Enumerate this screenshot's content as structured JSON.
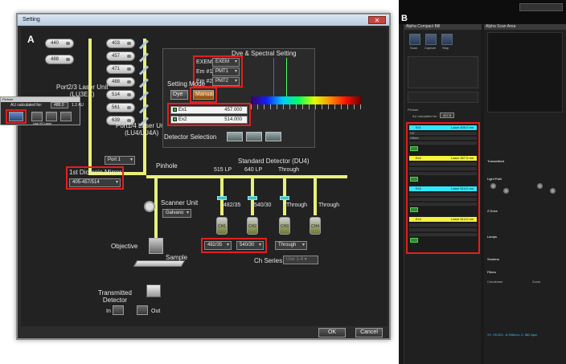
{
  "panel_a": {
    "letter": "A",
    "window_title": "Setting",
    "close_label": "✕",
    "lasers_left": [
      "440",
      "488"
    ],
    "lasers_right": [
      "403",
      "457",
      "471",
      "488",
      "514",
      "561",
      "639"
    ],
    "laser_unit_left": "Port2/3 Laser Unit\n(LU3EX)",
    "laser_unit_right": "Port1/4 Laser Unit\n(LU4/LU4A)",
    "dye_title": "Dye & Spectral Setting",
    "exem_rows": [
      {
        "label": "EXEM",
        "value": "EXEM"
      },
      {
        "label": "Em #1",
        "value": "PMT1"
      },
      {
        "label": "Em #2",
        "value": "PMT2"
      }
    ],
    "setting_mode": "Setting Mode",
    "mode_buttons": [
      "Dye",
      "Manual"
    ],
    "ex_lines": [
      {
        "label": "Ex1",
        "value": "457.000"
      },
      {
        "label": "Ex2",
        "value": "514.000"
      }
    ],
    "detector_selection": "Detector Selection",
    "port_select": "Port 1",
    "dichroic_label": "1st Dichroic Mirror",
    "dichroic_value": "405-457/514",
    "pinhole": "Pinhole",
    "standard_detector": "Standard Detector (DU4)",
    "dichroics_top": [
      "515 LP",
      "640 LP",
      "Through"
    ],
    "filters": [
      "482/35",
      "540/30",
      "Through",
      "Through"
    ],
    "pmts": [
      "CH1",
      "CH2",
      "CH3",
      "CH4"
    ],
    "filter_dropdowns": [
      "482/35",
      "540/30",
      "Through"
    ],
    "scanner_unit": "Scanner Unit",
    "scanner_value": "Galvano",
    "objective": "Objective",
    "sample": "Sample",
    "ch_series": "Ch Series",
    "ch_series_value": "Use 1-4 ▾",
    "transmitted": "Transmitted\nDetector",
    "tdet_in": "In",
    "tdet_out": "Out",
    "ok": "OK",
    "cancel": "Cancel",
    "popup": {
      "title": "Pinhole",
      "au_label": "AU calculated for:",
      "au_value": "488.0",
      "size_label": "1.2 AU",
      "um_label": "μm",
      "use_bl": "Use IR Laser"
    }
  },
  "panel_b": {
    "letter": "B",
    "left_title": "Alpha Compact Bill",
    "right_title": "Alpha Scan Area",
    "tools": [
      "Scan",
      "Capture",
      "Stop"
    ],
    "pinhole_label": "Pinhole",
    "au_label": "AU calculated for:",
    "au_value": "417.5",
    "channels": [
      {
        "name": "Ex1",
        "laser": "Laser 405.0 nm",
        "color": "#2ee8ff"
      },
      {
        "name": "Ex2",
        "laser": "Laser 457.0 nm",
        "color": "#f4f23a"
      },
      {
        "name": "Ex3",
        "laser": "Laser 514.0 nm",
        "color": "#2ee8ff"
      },
      {
        "name": "Ex4",
        "laser": "Laser 514.0 nm",
        "color": "#f4f23a"
      }
    ],
    "slider_labels": [
      "HV",
      "Offset",
      "Gain"
    ],
    "right_sections": [
      "Transmitted",
      "Light Path",
      "Z Drive",
      "Lamps",
      "Shutters",
      "Filters"
    ],
    "condenser": "Condenser",
    "zoom": "Zoom",
    "status": "XY: 25.001; -8.995mm; Z: 882.8μm"
  },
  "colors": {
    "red_box": "#e31f1f",
    "beam": "#e8f07a",
    "dialog_bg": "#222222"
  }
}
